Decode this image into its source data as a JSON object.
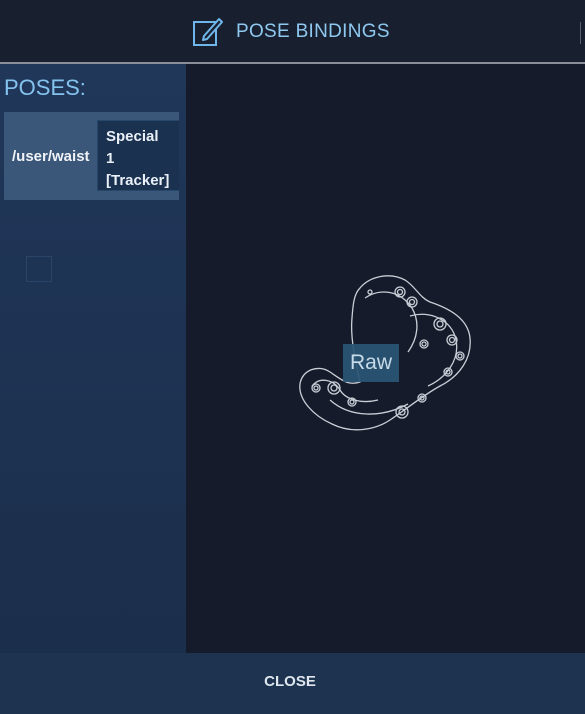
{
  "header": {
    "title": "POSE BINDINGS",
    "icon": "edit-icon"
  },
  "sidebar": {
    "heading": "POSES:",
    "items": [
      {
        "path": "/user/waist",
        "device_lines": [
          "Special",
          "1",
          "[Tracker]"
        ]
      }
    ]
  },
  "preview": {
    "device_image": "vive-tracker-outline",
    "label": "Raw"
  },
  "footer": {
    "close_label": "CLOSE"
  },
  "colors": {
    "accent": "#8fc8ef",
    "sidebar_bg": "#20375a",
    "content_bg": "#151b2b"
  }
}
